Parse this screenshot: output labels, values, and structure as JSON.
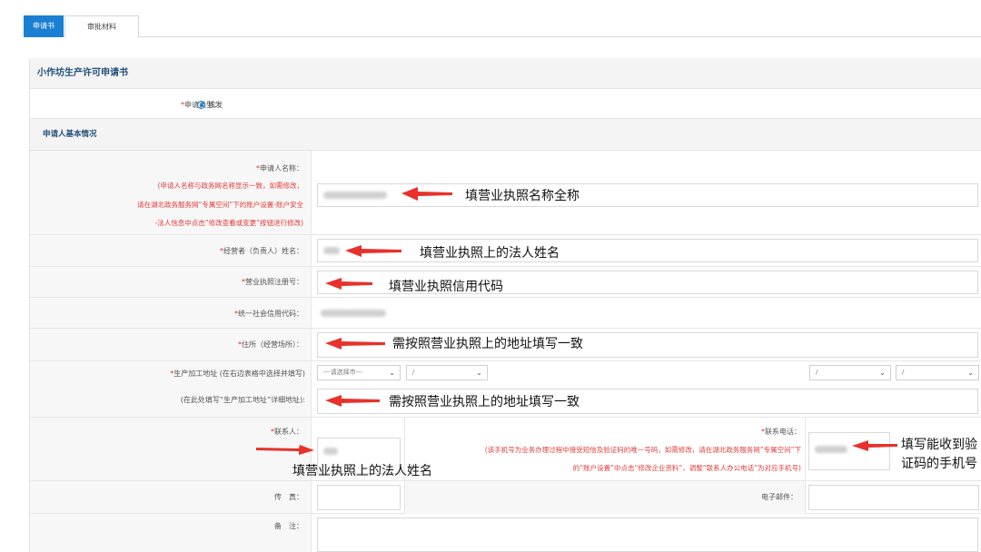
{
  "tabs": [
    {
      "label": "申请书",
      "active": true
    },
    {
      "label": "审批材料",
      "active": false
    }
  ],
  "form": {
    "title": "小作坊生产许可申请书",
    "apply_type": {
      "label": "申请类型：",
      "option": "核发",
      "selected": true
    },
    "section_basic": "申请人基本情况",
    "applicant_name": {
      "label": "申请人名称：",
      "note_lines": [
        "(申请人名称与政务网名称显示一致，如需修改，",
        "请在湖北政务服务网“专属空间”下的账户设置-账户安全",
        "-法人信息中点击“修改查看或变更”按钮进行修改)"
      ]
    },
    "operator_name": {
      "label": "经营者（负责人）姓名："
    },
    "license_no": {
      "label": "营业执照注册号："
    },
    "credit_code": {
      "label": "统一社会信用代码："
    },
    "residence": {
      "label": "住所（经营场所）："
    },
    "production_address": {
      "label": "生产加工地址 (在右边表格中选择并填写)",
      "select_province": "---请选择市---",
      "select_slash": "/",
      "detail_label": "(在此处填写“生产加工地址”详细地址):"
    },
    "contact": {
      "label": "联系人："
    },
    "contact_phone": {
      "label": "联系电话：",
      "note_lines": [
        "(该手机号为业务办理过程中接受短信及验证码的唯一号码，如需修改，请在湖北政务服务网“专属空间”下",
        "的“账户设置”中点击“修改企业资料”，调整“联系人办公电话”为对应手机号)"
      ]
    },
    "fax": {
      "label": "传　真："
    },
    "email": {
      "label": "电子邮件："
    },
    "remark": {
      "label": "备　注："
    }
  },
  "annotations": {
    "a1": "填营业执照名称全称",
    "a2": "填营业执照上的法人姓名",
    "a3": "填营业执照信用代码",
    "a4": "需按照营业执照上的地址填写一致",
    "a5": "需按照营业执照上的地址填写一致",
    "a6": "填营业执照上的法人姓名",
    "a7_line1": "填写能收到验",
    "a7_line2": "证码的手机号"
  },
  "colors": {
    "accent": "#1b7fd3",
    "required": "#e03030",
    "arrow": "#e8312b",
    "title": "#1f4e79"
  }
}
